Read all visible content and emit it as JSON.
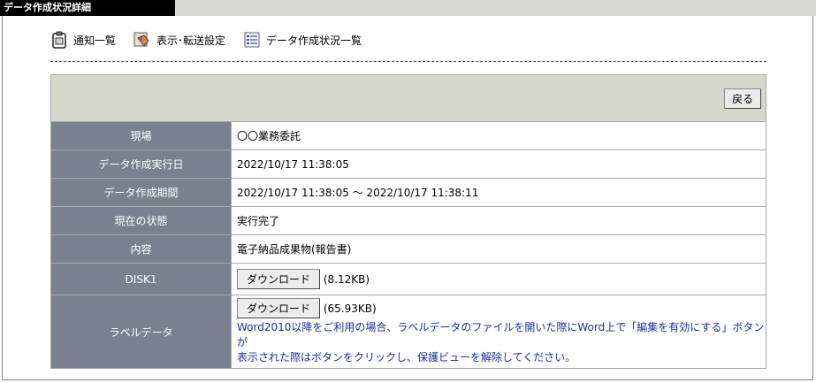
{
  "window": {
    "title": "データ作成状況詳細"
  },
  "nav": {
    "items": [
      {
        "label": "通知一覧",
        "icon": "clipboard-icon"
      },
      {
        "label": "表示･転送設定",
        "icon": "settings-hand-icon"
      },
      {
        "label": "データ作成状況一覧",
        "icon": "list-icon"
      }
    ]
  },
  "toolbar": {
    "back_label": "戻る"
  },
  "rows": {
    "site": {
      "label": "現場",
      "value": "〇〇業務委託"
    },
    "exec_date": {
      "label": "データ作成実行日",
      "value": "2022/10/17 11:38:05"
    },
    "period": {
      "label": "データ作成期間",
      "value": "2022/10/17 11:38:05 ～ 2022/10/17 11:38:11"
    },
    "status": {
      "label": "現在の状態",
      "value": "実行完了"
    },
    "content": {
      "label": "内容",
      "value": "電子納品成果物(報告書)"
    },
    "disk1": {
      "label": "DISK1",
      "button": "ダウンロード",
      "size": "(8.12KB)"
    },
    "label_data": {
      "label": "ラベルデータ",
      "button": "ダウンロード",
      "size": "(65.93KB)",
      "note_line1": "Word2010以降をご利用の場合、ラベルデータのファイルを開いた際にWord上で「編集を有効にする」ボタンが",
      "note_line2": "表示された際はボタンをクリックし、保護ビューを解除してください。"
    }
  }
}
